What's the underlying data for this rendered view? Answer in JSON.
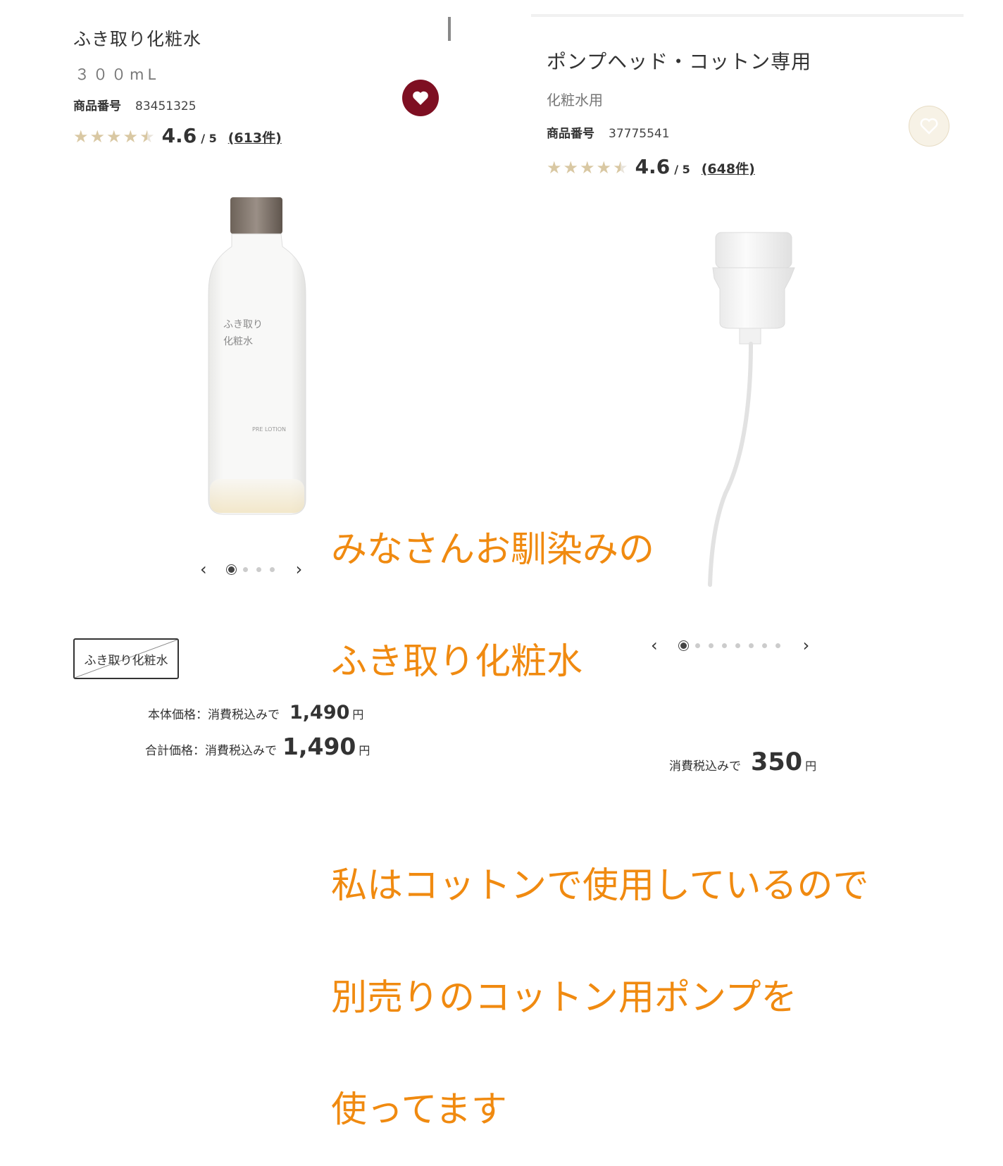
{
  "left_product": {
    "title": "ふき取り化粧水",
    "subtitle": "３００mL",
    "code_label": "商品番号",
    "code": "83451325",
    "rating": {
      "stars_value": 4.6,
      "score": "4.6",
      "out_of": "/ 5",
      "count": "(613件)"
    },
    "favorite": {
      "state": "on",
      "icon": "heart-icon",
      "color": "#7e0f22"
    },
    "image": {
      "bottle_text_line1": "ふき取り",
      "bottle_text_line2": "化粧水",
      "bottle_label_en": "PRE LOTION"
    },
    "carousel": {
      "prev_icon": "chevron-left-icon",
      "next_icon": "chevron-right-icon",
      "total": 4,
      "active": 0
    },
    "variant_option": "ふき取り化粧水",
    "prices": [
      {
        "label": "本体価格：消費税込みで",
        "amount": "1,490",
        "unit": "円"
      },
      {
        "label": "合計価格：消費税込みで",
        "amount": "1,490",
        "unit": "円"
      }
    ]
  },
  "right_product": {
    "title": "ポンプヘッド・コットン専用",
    "subtitle": "化粧水用",
    "code_label": "商品番号",
    "code": "37775541",
    "rating": {
      "stars_value": 4.6,
      "score": "4.6",
      "out_of": "/ 5",
      "count": "(648件)"
    },
    "favorite": {
      "state": "off",
      "icon": "heart-outline-icon",
      "color": "#f7f2e6"
    },
    "carousel": {
      "prev_icon": "chevron-left-icon",
      "next_icon": "chevron-right-icon",
      "total": 8,
      "active": 0
    },
    "price": {
      "label": "消費税込みで",
      "amount": "350",
      "unit": "円"
    }
  },
  "overlay_caption": {
    "color": "#f08a10",
    "lines": [
      "みなさんお馴染みの",
      "ふき取り化粧水",
      "",
      "私はコットンで使用しているので",
      "別売りのコットン用ポンプを",
      "使ってます"
    ]
  }
}
